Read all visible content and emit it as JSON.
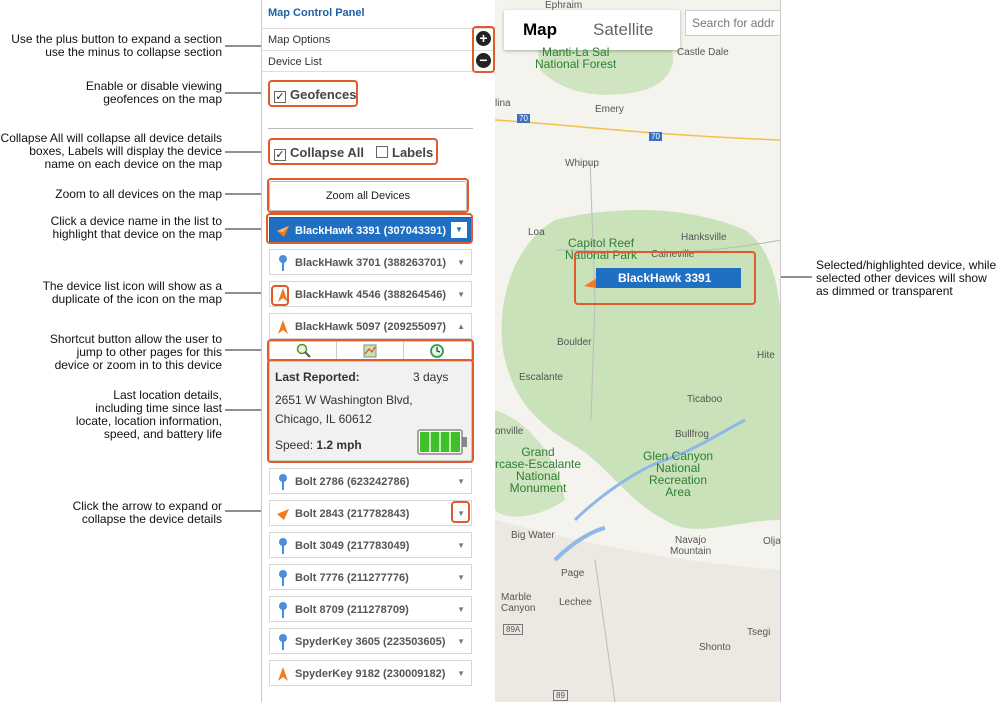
{
  "annotations": {
    "plus_minus": "Use the plus button to expand a section\nuse the minus to collapse section",
    "geofences": "Enable or disable viewing\ngeofences on the map",
    "collapse_labels": "Collapse All will collapse all device details\nboxes, Labels will display the device\nname on each device on the map",
    "zoom": "Zoom to all devices on the map",
    "click_name": "Click a device name in the list to\nhighlight that device on the map",
    "list_icon": "The device list icon will show as a\nduplicate of the icon on the map",
    "shortcut": "Shortcut button allow the user to\njump to other pages for this\ndevice or zoom in to this device",
    "last_location": "Last location details,\nincluding time since last\nlocate, location information,\nspeed, and battery life",
    "arrow": "Click the arrow to expand or\ncollapse the device details",
    "selected": "Selected/highlighted device, while\nselected other devices will show\nas dimmed or transparent"
  },
  "panel": {
    "title": "Map Control Panel",
    "map_options": "Map Options",
    "device_list": "Device List",
    "geofences": "Geofences",
    "collapse_all": "Collapse All",
    "labels": "Labels",
    "zoom_all": "Zoom all Devices"
  },
  "devices": [
    {
      "label": "BlackHawk 3391 (307043391)",
      "icon": "arrow-orange-icon",
      "state": "selected"
    },
    {
      "label": "BlackHawk 3701 (388263701)",
      "icon": "pin-blue-icon"
    },
    {
      "label": "BlackHawk 4546 (388264546)",
      "icon": "arrow-up-orange-icon"
    },
    {
      "label": "BlackHawk 5097 (209255097)",
      "icon": "arrow-up-orange-icon",
      "state": "expanded"
    },
    {
      "label": "Bolt 2786 (623242786)",
      "icon": "pin-blue-icon"
    },
    {
      "label": "Bolt 2843 (217782843)",
      "icon": "arrow-orange-icon"
    },
    {
      "label": "Bolt 3049 (217783049)",
      "icon": "pin-blue-icon"
    },
    {
      "label": "Bolt 7776 (211277776)",
      "icon": "pin-blue-icon"
    },
    {
      "label": "Bolt 8709 (211278709)",
      "icon": "pin-blue-icon"
    },
    {
      "label": "SpyderKey 3605 (223503605)",
      "icon": "pin-blue-icon"
    },
    {
      "label": "SpyderKey 9182 (230009182)",
      "icon": "arrow-up-orange-icon"
    }
  ],
  "details": {
    "last_reported_label": "Last Reported:",
    "last_reported_value": "3 days",
    "address_line1": "2651 W Washington Blvd,",
    "address_line2": "Chicago, IL 60612",
    "speed_label": "Speed:",
    "speed_value": "1.2 mph",
    "battery_level": 1.0
  },
  "map": {
    "tab_map": "Map",
    "tab_satellite": "Satellite",
    "search_placeholder": "Search for addr",
    "popup_label": "BlackHawk 3391",
    "places": [
      {
        "text": "Ephraim"
      },
      {
        "text": "Manti-La Sal\nNational Forest"
      },
      {
        "text": "Castle Dale"
      },
      {
        "text": "Emery"
      },
      {
        "text": "lina"
      },
      {
        "text": "70"
      },
      {
        "text": "70"
      },
      {
        "text": "Whipup"
      },
      {
        "text": "Loa"
      },
      {
        "text": "Capitol Reef\nNational Park"
      },
      {
        "text": "Caineville"
      },
      {
        "text": "Hanksville"
      },
      {
        "text": "Boulder"
      },
      {
        "text": "Escalante"
      },
      {
        "text": "Hite"
      },
      {
        "text": "Ticaboo"
      },
      {
        "text": "onville"
      },
      {
        "text": "Bullfrog"
      },
      {
        "text": "Grand\nrcase-Escalante\nNational\nMonument"
      },
      {
        "text": "Glen Canyon\nNational\nRecreation\nArea"
      },
      {
        "text": "Big Water"
      },
      {
        "text": "Navajo\nMountain"
      },
      {
        "text": "Olja"
      },
      {
        "text": "Page"
      },
      {
        "text": "Marble\nCanyon"
      },
      {
        "text": "Lechee"
      },
      {
        "text": "89A"
      },
      {
        "text": "Tsegi"
      },
      {
        "text": "Shonto"
      },
      {
        "text": "89"
      }
    ]
  }
}
